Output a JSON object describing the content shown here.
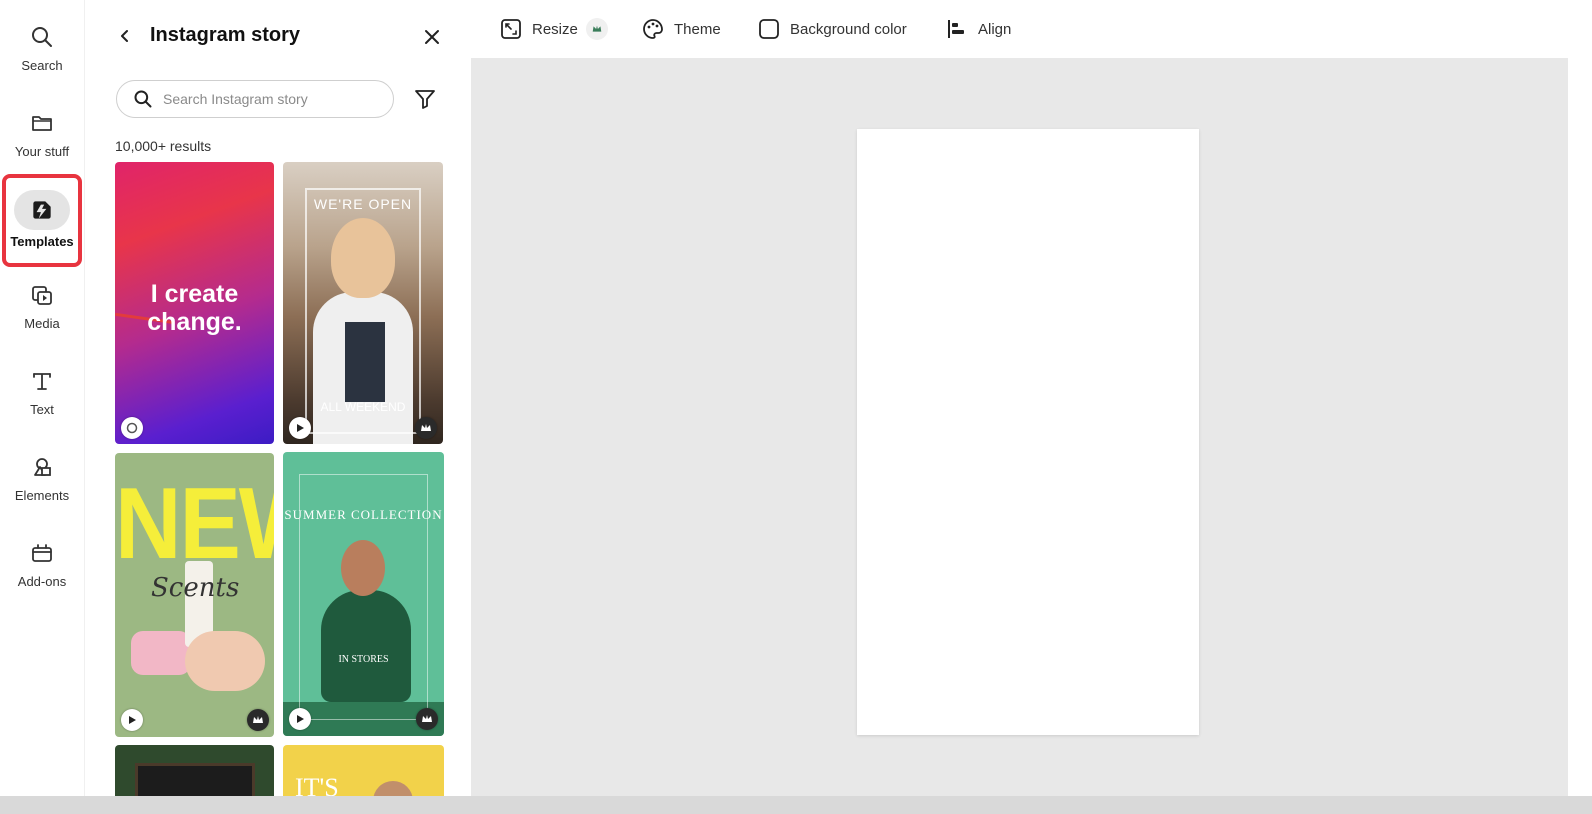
{
  "rail": {
    "items": [
      {
        "label": "Search",
        "icon": "search-icon"
      },
      {
        "label": "Your stuff",
        "icon": "folder-icon"
      },
      {
        "label": "Templates",
        "icon": "templates-icon",
        "active": true
      },
      {
        "label": "Media",
        "icon": "media-icon"
      },
      {
        "label": "Text",
        "icon": "text-icon"
      },
      {
        "label": "Elements",
        "icon": "elements-icon"
      },
      {
        "label": "Add-ons",
        "icon": "add-ons-icon"
      }
    ],
    "highlight_color": "#e8343f"
  },
  "panel": {
    "title": "Instagram story",
    "search_placeholder": "Search Instagram story",
    "results_count": "10,000+ results",
    "thumbnails": [
      {
        "text": "I create change."
      },
      {
        "text_top": "WE'RE OPEN",
        "text_bottom": "ALL WEEKEND"
      },
      {
        "text_big": "NEW",
        "text_script": "Scents"
      },
      {
        "text": "SUMMER COLLECTION",
        "text_bottom": "IN STORES"
      },
      {},
      {
        "text": "IT'S"
      }
    ]
  },
  "toolbar": {
    "resize": "Resize",
    "theme": "Theme",
    "background_color": "Background color",
    "align": "Align"
  },
  "colors": {
    "canvas_bg": "#e8e8e8",
    "artboard": "#ffffff"
  }
}
